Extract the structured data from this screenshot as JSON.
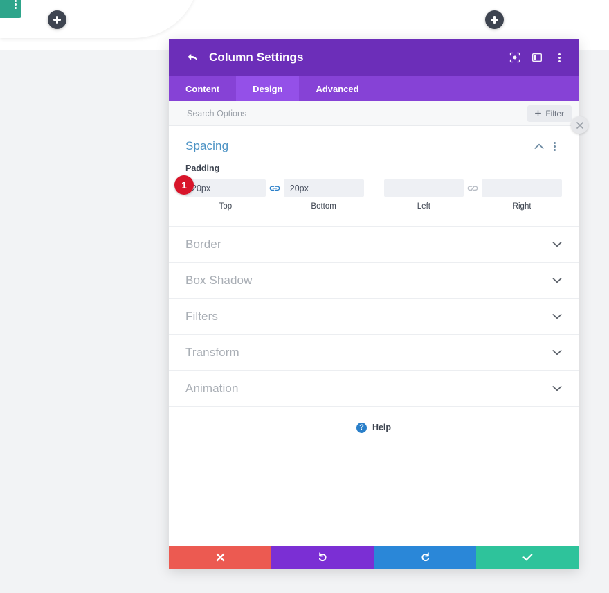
{
  "background": {
    "module_bar": {
      "icon": "vertical-dots-icon",
      "color": "#2ea58b"
    },
    "add_buttons": [
      {
        "icon": "plus-icon",
        "label": "+"
      },
      {
        "icon": "plus-icon",
        "label": "+"
      }
    ]
  },
  "modal": {
    "header": {
      "back_icon": "back-arrow-icon",
      "title": "Column Settings",
      "icons": [
        {
          "name": "focus-target-icon"
        },
        {
          "name": "split-layout-icon"
        },
        {
          "name": "vertical-dots-icon"
        }
      ],
      "close_icon": "close-icon",
      "bg_color": "#6c2eb9"
    },
    "tabs": [
      {
        "label": "Content",
        "active": false
      },
      {
        "label": "Design",
        "active": true
      },
      {
        "label": "Advanced",
        "active": false
      }
    ],
    "search": {
      "placeholder": "Search Options",
      "value": "",
      "filter_button": {
        "label": "Filter",
        "icon": "plus-icon"
      }
    },
    "spacing": {
      "title": "Spacing",
      "collapse_icon": "chevron-up-icon",
      "menu_icon": "vertical-dots-icon",
      "step_badge": "1",
      "padding": {
        "label": "Padding",
        "fields": [
          {
            "caption": "Top",
            "value": "20px",
            "placeholder": ""
          },
          {
            "caption": "Bottom",
            "value": "20px",
            "placeholder": ""
          },
          {
            "caption": "Left",
            "value": "",
            "placeholder": ""
          },
          {
            "caption": "Right",
            "value": "",
            "placeholder": ""
          }
        ],
        "link_top_bottom": {
          "icon": "link-icon",
          "linked": true,
          "color": "#2a7fc9"
        },
        "link_left_right": {
          "icon": "broken-link-icon",
          "linked": false,
          "color": "#b9bec6"
        }
      }
    },
    "sections": [
      {
        "label": "Border",
        "icon": "chevron-down-icon"
      },
      {
        "label": "Box Shadow",
        "icon": "chevron-down-icon"
      },
      {
        "label": "Filters",
        "icon": "chevron-down-icon"
      },
      {
        "label": "Transform",
        "icon": "chevron-down-icon"
      },
      {
        "label": "Animation",
        "icon": "chevron-down-icon"
      }
    ],
    "help": {
      "label": "Help",
      "icon": "question-mark-icon",
      "color": "#2a7fc9"
    },
    "footer": [
      {
        "name": "cancel",
        "icon": "close-x-icon",
        "color": "#ec5a51"
      },
      {
        "name": "undo",
        "icon": "undo-icon",
        "color": "#7b2fd4"
      },
      {
        "name": "redo",
        "icon": "redo-icon",
        "color": "#2a87d8"
      },
      {
        "name": "save",
        "icon": "checkmark-icon",
        "color": "#2ec39b"
      }
    ]
  }
}
